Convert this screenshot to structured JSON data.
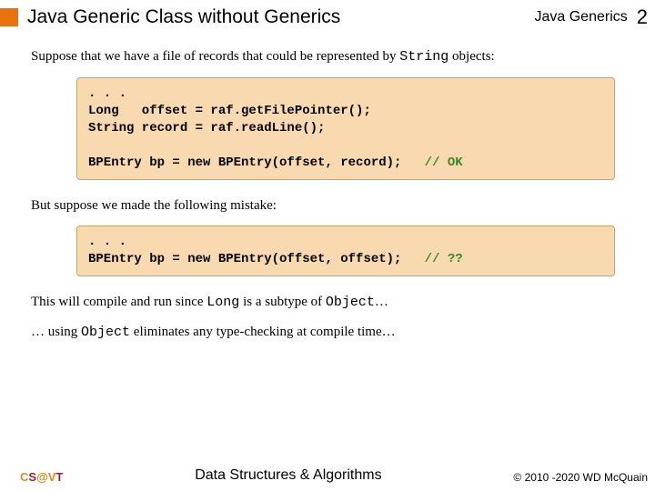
{
  "header": {
    "title": "Java Generic Class without Generics",
    "topic": "Java Generics",
    "page": "2"
  },
  "body": {
    "intro": "Suppose that we have a file of records that could be represented by ",
    "intro_mono": "String",
    "intro_tail": " objects:",
    "code1_a": ". . .\nLong   offset = raf.getFilePointer();\nString record = raf.readLine();\n\nBPEntry bp = new BPEntry(offset, record);   ",
    "code1_comment": "// OK",
    "mid": "But suppose we made the following mistake:",
    "code2_a": ". . .\nBPEntry bp = new BPEntry(offset, offset);   ",
    "code2_comment": "// ??",
    "line3_a": "This will compile and run since ",
    "line3_mono1": "Long",
    "line3_b": " is a subtype of ",
    "line3_mono2": "Object",
    "line3_c": "…",
    "line4_a": "… using ",
    "line4_mono": "Object",
    "line4_b": " eliminates any type-checking at compile time…"
  },
  "footer": {
    "brand_c": "C",
    "brand_s": "S",
    "brand_at": "@",
    "brand_v": "V",
    "brand_t": "T",
    "center": "Data Structures & Algorithms",
    "right": "© 2010 -2020 WD McQuain"
  }
}
